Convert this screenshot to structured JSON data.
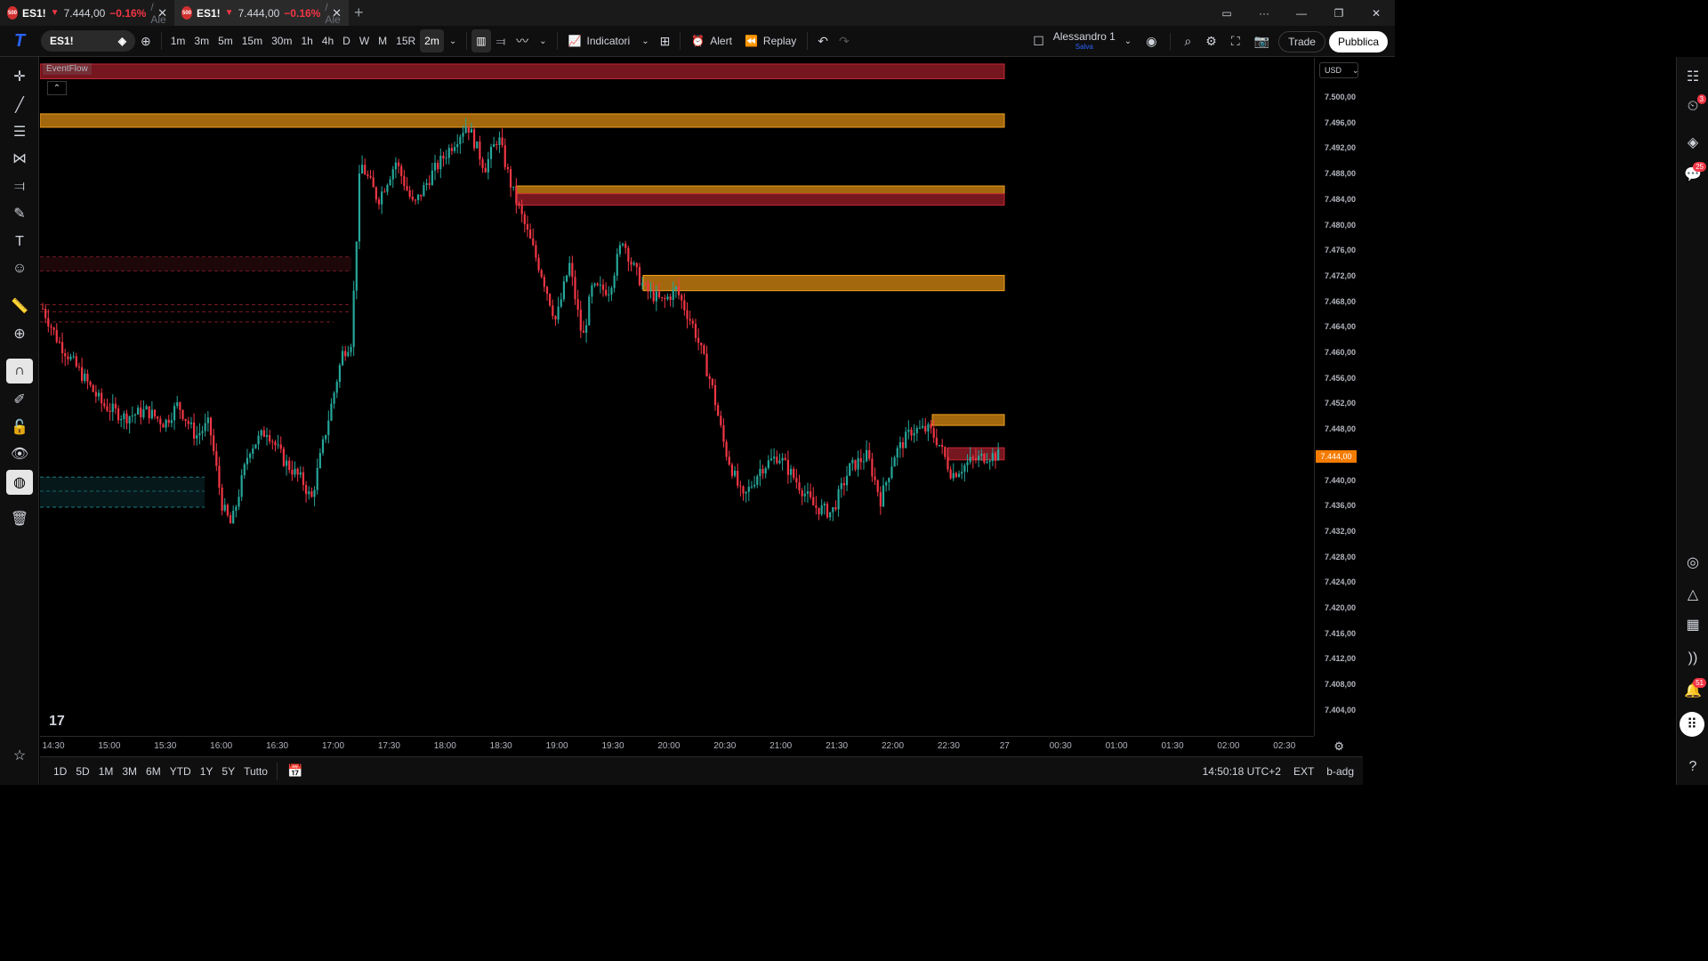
{
  "tabs": [
    {
      "badge": "500",
      "symbol": "ES1!",
      "price": "7.444,00",
      "change": "−0.16%",
      "rest": "/ Ale"
    },
    {
      "badge": "500",
      "symbol": "ES1!",
      "price": "7.444,00",
      "change": "−0.16%",
      "rest": "/ Ale"
    }
  ],
  "toolbar": {
    "symbol": "ES1!",
    "timeframes": [
      "1m",
      "3m",
      "5m",
      "15m",
      "30m",
      "1h",
      "4h",
      "D",
      "W",
      "M",
      "15R",
      "2m"
    ],
    "active_timeframe": "2m",
    "indicators_label": "Indicatori",
    "alert_label": "Alert",
    "replay_label": "Replay",
    "user_name": "Alessandro 1",
    "user_status": "Salva",
    "trade_label": "Trade",
    "publish_label": "Pubblica"
  },
  "chart": {
    "indicator_label": "EventFlow",
    "currency": "USD",
    "current_price": "7.444,00",
    "price_labels": [
      "7.500,00",
      "7.496,00",
      "7.492,00",
      "7.488,00",
      "7.484,00",
      "7.480,00",
      "7.476,00",
      "7.472,00",
      "7.468,00",
      "7.464,00",
      "7.460,00",
      "7.456,00",
      "7.452,00",
      "7.448,00",
      "7.440,00",
      "7.436,00",
      "7.432,00",
      "7.428,00",
      "7.424,00",
      "7.420,00",
      "7.416,00",
      "7.412,00",
      "7.408,00",
      "7.404,00"
    ],
    "time_labels": [
      "14:30",
      "15:00",
      "15:30",
      "16:00",
      "16:30",
      "17:00",
      "17:30",
      "18:00",
      "18:30",
      "19:00",
      "19:30",
      "20:00",
      "20:30",
      "21:00",
      "21:30",
      "22:00",
      "22:30",
      "27",
      "00:30",
      "01:00",
      "01:30",
      "02:00",
      "02:30"
    ],
    "colors": {
      "up": "#26a69a",
      "down": "#f23645",
      "supply_zone": "#8b1a24",
      "demand_zone": "#d98a12",
      "current_price": "#f57c00"
    }
  },
  "bottombar": {
    "ranges": [
      "1D",
      "5D",
      "1M",
      "3M",
      "6M",
      "YTD",
      "1Y",
      "5Y",
      "Tutto"
    ],
    "clock": "14:50:18 UTC+2",
    "session": "EXT",
    "adjust": "b-adg"
  },
  "right_badges": {
    "alerts_clock": "3",
    "chat": "25",
    "notifications": "51"
  }
}
